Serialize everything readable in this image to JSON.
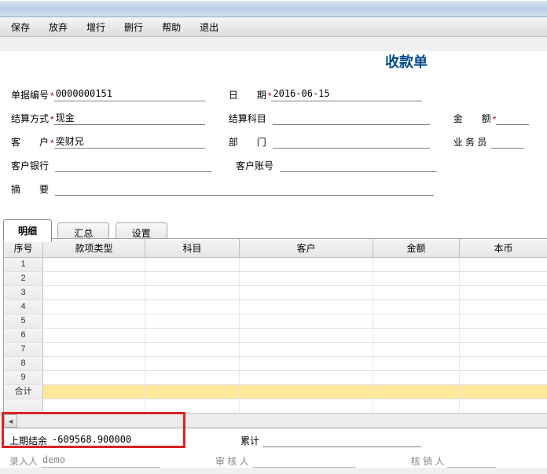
{
  "menu": {
    "save": "保存",
    "discard": "放弃",
    "addrow": "增行",
    "delrow": "删行",
    "help": "帮助",
    "exit": "退出"
  },
  "doc": {
    "title": "收款单"
  },
  "form": {
    "doc_no_lbl": "单据编号",
    "doc_no": "0000000151",
    "date_lbl": "日　　期",
    "date": "2016-06-15",
    "settle_lbl": "结算方式",
    "settle": "现金",
    "subject_lbl": "结算科目",
    "subject": "",
    "amt_lbl": "金　　额",
    "amt": "",
    "cust_lbl": "客　　户",
    "cust": "奕财兄",
    "dept_lbl": "部　　门",
    "dept": "",
    "sales_lbl": "业 务 员",
    "sales": "",
    "bank_lbl": "客户银行",
    "bank": "",
    "acct_lbl": "客户账号",
    "acct": "",
    "memo_lbl": "摘　　要",
    "memo": ""
  },
  "tabs": {
    "detail": "明细",
    "summary": "汇总",
    "settings": "设置"
  },
  "grid": {
    "cols": {
      "no": "序号",
      "type": "款项类型",
      "subject": "科目",
      "cust": "客户",
      "amt": "金额",
      "local": "本币"
    },
    "rows": [
      "1",
      "2",
      "3",
      "4",
      "5",
      "6",
      "7",
      "8",
      "9"
    ],
    "total": "合计"
  },
  "foot": {
    "prev_lbl": "上期结余",
    "prev": "-609568.900000",
    "cum_lbl": "累计",
    "cum": "",
    "maker_lbl": "录入人",
    "maker": "demo",
    "auditor_lbl": "审 核 人",
    "auditor": "",
    "writeoff_lbl": "核 销 人",
    "writeoff": ""
  }
}
